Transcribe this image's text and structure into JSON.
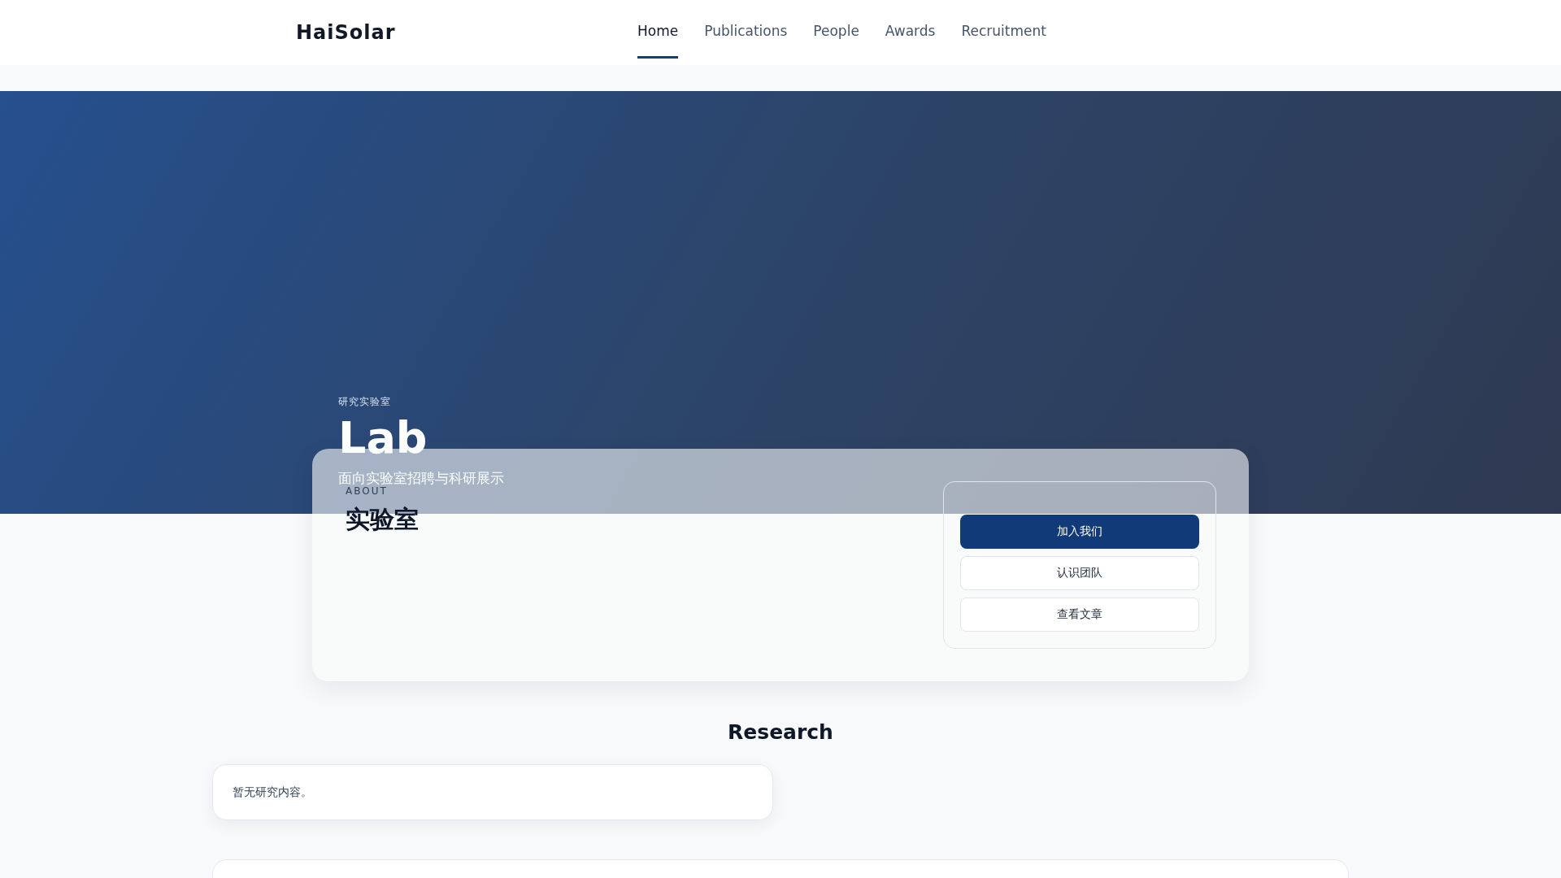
{
  "header": {
    "logo": "HaiSolar",
    "nav": [
      {
        "label": "Home",
        "selected": true
      },
      {
        "label": "Publications",
        "selected": false
      },
      {
        "label": "People",
        "selected": false
      },
      {
        "label": "Awards",
        "selected": false
      },
      {
        "label": "Recruitment",
        "selected": false
      }
    ]
  },
  "hero": {
    "eyebrow": "研究实验室",
    "title": "Lab",
    "subtitle": "面向实验室招聘与科研展示"
  },
  "about": {
    "label": "ABOUT",
    "title": "实验室",
    "actions": [
      {
        "label": "加入我们",
        "kind": "primary"
      },
      {
        "label": "认识团队",
        "kind": "secondary"
      },
      {
        "label": "查看文章",
        "kind": "secondary"
      }
    ]
  },
  "research": {
    "heading": "Research",
    "empty_text": "暂无研究内容。"
  }
}
